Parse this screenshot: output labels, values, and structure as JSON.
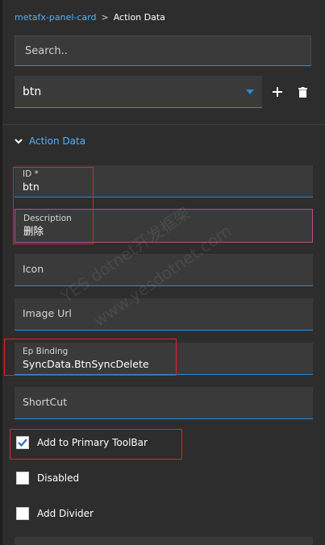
{
  "breadcrumb": {
    "parent": "metafx-panel-card",
    "separator": ">",
    "current": "Action Data"
  },
  "search": {
    "placeholder": "Search.."
  },
  "selector": {
    "value": "btn"
  },
  "section": {
    "title": "Action Data"
  },
  "fields": {
    "id": {
      "label": "ID *",
      "value": "btn"
    },
    "description": {
      "label": "Description",
      "value": "删除"
    },
    "icon": {
      "label": "Icon"
    },
    "image_url": {
      "label": "Image Url"
    },
    "ep_binding": {
      "label": "Ep Binding",
      "value": "SyncData.BtnSyncDelete"
    },
    "shortcut": {
      "label": "ShortCut"
    }
  },
  "checkboxes": {
    "primary_toolbar": {
      "label": "Add to Primary ToolBar",
      "checked": true
    },
    "disabled": {
      "label": "Disabled",
      "checked": false
    },
    "divider": {
      "label": "Add Divider",
      "checked": false
    }
  },
  "watermark": {
    "line1": "YES dotnet开发框架",
    "line2": "www.yesdotnet.com"
  },
  "colors": {
    "accent": "#2a8bd6",
    "link": "#4fb3ff",
    "highlight": "#e0242a",
    "background": "#2d2d2d"
  }
}
